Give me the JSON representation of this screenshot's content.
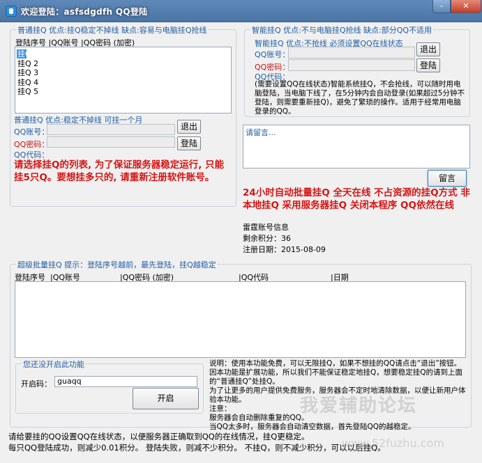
{
  "window": {
    "title": "欢迎登陆：asfsdgdfh   QQ登陆",
    "min_label": "–",
    "close_label": "✕"
  },
  "normal_group": {
    "legend": "普通挂Q 优点:挂Q稳定不掉线 缺点:容易与电脑挂Q抢线",
    "header": "登陆序号 |QQ账号 |QQ密码 (加密)",
    "slots": [
      "挂Q 1",
      "挂Q 2",
      "挂Q 3",
      "挂Q 4",
      "挂Q 5"
    ]
  },
  "normal_login": {
    "legend": "普通挂Q 优点:稳定不掉线 可挂一个月",
    "qq_account_label": "QQ账号：",
    "qq_password_label": "QQ密码：",
    "qq_code_label": "QQ代码：",
    "logout_label": "退出",
    "login_label": "登陆",
    "warning": "请选择挂Q的列表, 为了保证服务器稳定运行, 只能挂5只Q。要想挂多只的, 请重新注册软件账号。"
  },
  "smart_group": {
    "legend": "智能挂Q 优点:不与电脑挂Q抢线 缺点:部分QQ不适用",
    "sub_legend": "智能挂Q 优点:不抢线 必须设置QQ在线状态",
    "qq_account_label": "QQ账号：",
    "qq_password_label": "QQ密码：",
    "qq_code_label": "QQ代码：",
    "logout_label": "退出",
    "login_label": "登陆",
    "description": "(需要设置QQ在线状态)智能系统挂Q，不会抢线，可以随时用电脑登陆，当电脑下线了，在5分钟内会自动登录(如果超过5分钟不登陆，则需要重新挂Q)，避免了繁琐的操作。适用于经常用电脑登录的QQ。"
  },
  "message": {
    "placeholder": "请留言...",
    "submit_label": "留言"
  },
  "promo_text": "24小时自动批量挂Q 全天在线 不占资源的挂Q方式 非本地挂Q 采用服务器挂Q 关闭本程序 QQ依然在线",
  "account_info": {
    "heading": "雷霆账号信息",
    "points_label": "剩余积分：",
    "points_value": "36",
    "reg_date_label": "注册日期：",
    "reg_date_value": "2015-08-09"
  },
  "batch_group": {
    "legend": "超级批量挂Q 提示：登陆序号越前，最先登陆，挂Q越稳定",
    "columns": [
      "登陆序号",
      "|QQ账号",
      "|QQ密码 (加密)",
      "|QQ代码",
      "|日期"
    ]
  },
  "unlock_group": {
    "legend": "您还没开启此功能",
    "code_label": "开启码：",
    "code_value": "guaqq",
    "open_label": "开启"
  },
  "instructions": {
    "p1": "说明：使用本功能免费，可以无限挂Q，如果不想挂的QQ请点击“退出”按钮。因本功能是扩展功能，所以我们不能保证稳定地挂Q，想要稳定挂Q的请到上面的“普通挂Q”处挂Q。",
    "p2": "为了让更多的用户提供免费服务，服务器会不定时地清除数据，以便让新用户体验本功能。",
    "notes_heading": "注意：",
    "note1": "服务器会自动删除重复的QQ。",
    "note2": "当QQ太多时，服务器会自动清空数据，首先登陆QQ的越稳定。"
  },
  "footer": {
    "line1": "请给要挂的QQ设置QQ在线状态，以便服务器正确取到QQ的在线情况，挂Q更稳定。",
    "line2": "每只QQ登陆成功，则减少0.01积分。 登陆失败，则减不少积分。 不挂Q，则不减少积分，可以以后挂Q。"
  },
  "watermark": {
    "text": "我爱辅助论坛",
    "url": "www.52fuzhu.com"
  }
}
